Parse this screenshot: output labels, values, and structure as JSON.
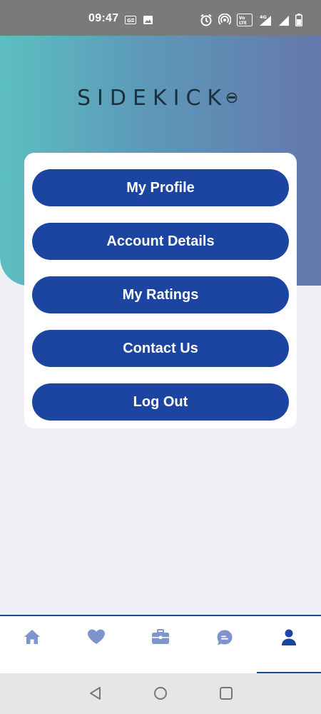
{
  "status_bar": {
    "time": "09:47",
    "icons": [
      "gallery-badge-icon",
      "image-icon",
      "alarm-icon",
      "hotspot-icon",
      "volte-icon",
      "signal-4g-icon",
      "signal-icon",
      "battery-icon"
    ],
    "volte_label": "VoLTE",
    "network_label": "4G"
  },
  "header": {
    "logo_text": "SIDEKICK",
    "gradient": [
      "#5cbfc1",
      "#6478ad"
    ]
  },
  "menu": {
    "items": [
      {
        "label": "My Profile"
      },
      {
        "label": "Account Details"
      },
      {
        "label": "My Ratings"
      },
      {
        "label": "Contact Us"
      },
      {
        "label": "Log Out"
      }
    ]
  },
  "bottom_nav": {
    "items": [
      {
        "icon": "home-icon",
        "active": false
      },
      {
        "icon": "heart-icon",
        "active": false
      },
      {
        "icon": "briefcase-icon",
        "active": false
      },
      {
        "icon": "chat-icon",
        "active": false
      },
      {
        "icon": "profile-icon",
        "active": true
      }
    ]
  },
  "system_nav": {
    "icons": [
      "back-icon",
      "home-circle-icon",
      "recents-icon"
    ]
  },
  "colors": {
    "accent": "#1b45a0",
    "nav_inactive": "#7f94cc",
    "page_bg": "#eef0f5"
  }
}
